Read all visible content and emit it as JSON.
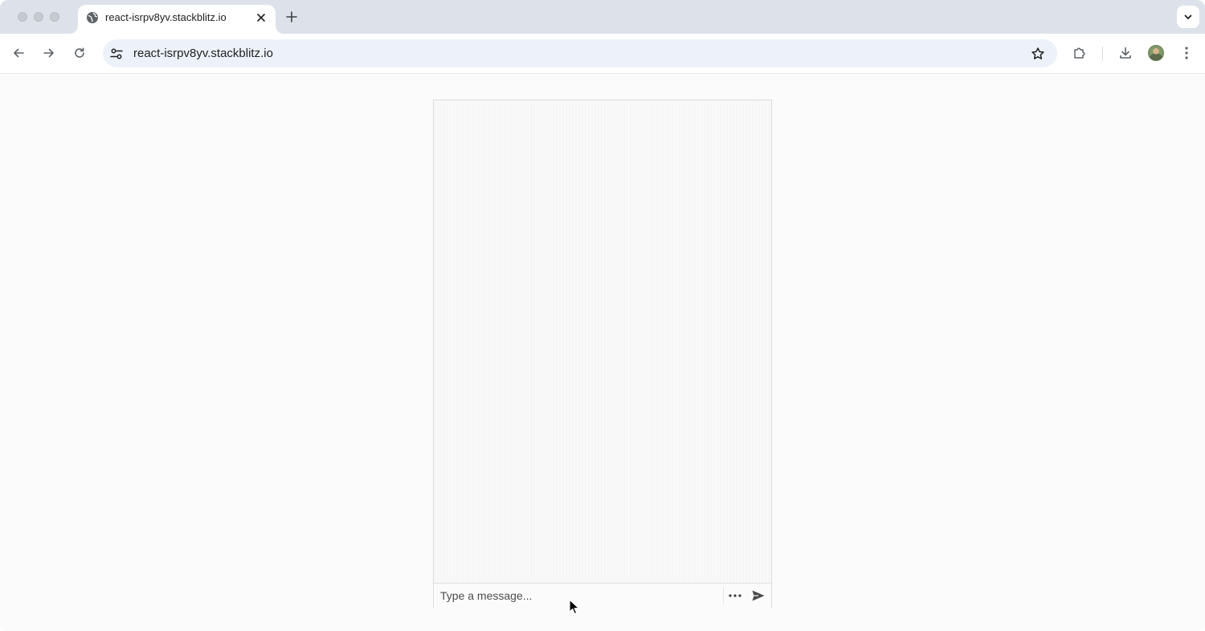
{
  "browser": {
    "tab": {
      "title": "react-isrpv8yv.stackblitz.io",
      "favicon": "globe-icon",
      "close_icon": "close-icon"
    },
    "new_tab_icon": "plus-icon",
    "tab_search_icon": "chevron-down-icon",
    "toolbar": {
      "back_icon": "arrow-left-icon",
      "forward_icon": "arrow-right-icon",
      "reload_icon": "reload-icon",
      "site_info_icon": "tune-icon",
      "url": "react-isrpv8yv.stackblitz.io",
      "bookmark_icon": "star-icon",
      "extensions_icon": "puzzle-icon",
      "downloads_icon": "download-icon",
      "profile_icon": "avatar",
      "menu_icon": "kebab-menu-icon"
    }
  },
  "chat": {
    "input": {
      "value": "",
      "placeholder": "Type a message..."
    },
    "more_icon": "more-horizontal-icon",
    "send_icon": "send-icon"
  },
  "colors": {
    "tabstrip_bg": "#dde2ea",
    "omnibox_bg": "#edf2fa",
    "page_bg": "#fbfbfc",
    "icon_gray": "#5f6368"
  }
}
